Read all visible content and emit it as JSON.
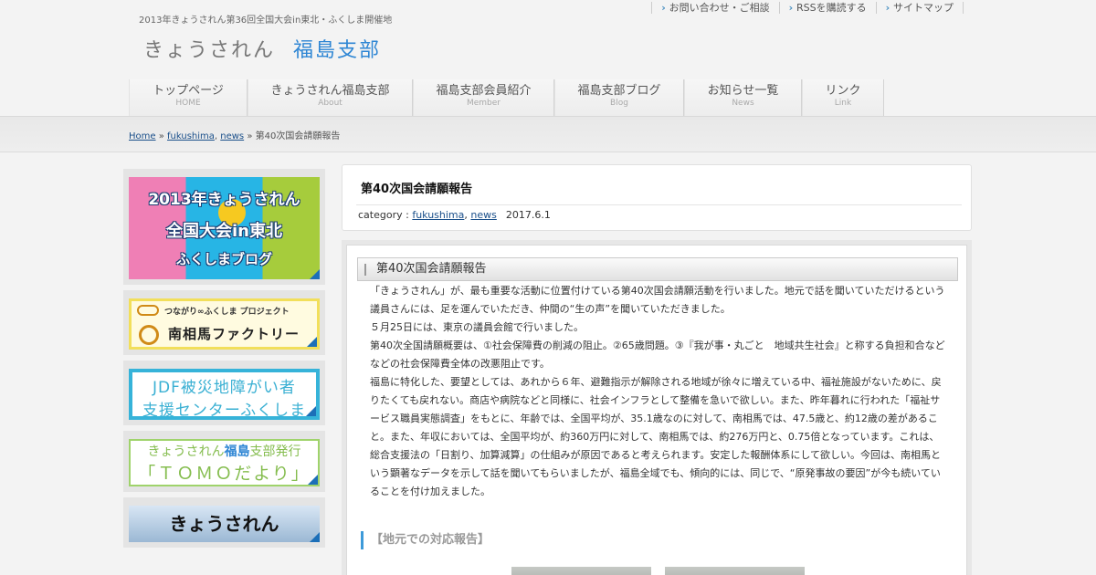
{
  "header": {
    "tagline": "2013年きょうされん第36回全国大会in東北・ふくしま開催地",
    "site_title_main": "きょうされん",
    "site_title_accent": "福島支部",
    "top_links": [
      "お問い合わせ・ご相談",
      "RSSを購読する",
      "サイトマップ"
    ]
  },
  "nav": [
    {
      "jp": "トップページ",
      "en": "HOME"
    },
    {
      "jp": "きょうされん福島支部",
      "en": "About"
    },
    {
      "jp": "福島支部会員紹介",
      "en": "Member"
    },
    {
      "jp": "福島支部ブログ",
      "en": "Blog"
    },
    {
      "jp": "お知らせ一覧",
      "en": "News"
    },
    {
      "jp": "リンク",
      "en": "Link"
    }
  ],
  "breadcrumb": {
    "home": "Home",
    "sep1": " » ",
    "cat1": "fukushima",
    "comma": ", ",
    "cat2": "news",
    "sep2": " » ",
    "current": "第40次国会請願報告"
  },
  "sidebar": {
    "banner1": {
      "line1": "2013年きょうされん",
      "line2": "全国大会in東北",
      "line3": "ふくしまブログ"
    },
    "banner2": {
      "line1": "つながり∞ふくしま プロジェクト",
      "line2": "南相馬ファクトリー"
    },
    "banner3": {
      "line1": "JDF被災地障がい者",
      "line2": "支援センターふくしま"
    },
    "banner4": {
      "pre": "きょうされん",
      "hl": "福島",
      "post": "支部発行",
      "line2": "「ＴＯＭＯだより」"
    },
    "banner5": {
      "line1": "きょうされん"
    }
  },
  "post_card": {
    "title": "第40次国会請願報告",
    "category_label": "category : ",
    "cat1": "fukushima",
    "comma": ", ",
    "cat2": "news",
    "date": "2017.6.1"
  },
  "post": {
    "heading": "第40次国会請願報告",
    "paragraphs": [
      "「きょうされん」が、最も重要な活動に位置付けている第40次国会請願活動を行いました。地元で話を聞いていただけるという議員さんには、足を運んでいただき、仲間の“生の声”を聞いていただきました。",
      "５月25日には、東京の議員会館で行いました。",
      "第40次全国請願概要は、①社会保障費の削減の阻止。②65歳問題。③『我が事・丸ごと　地域共生社会』と称する負担和合などなどの社会保障費全体の改悪阻止です。",
      "福島に特化した、要望としては、あれから６年、避難指示が解除される地域が徐々に増えている中、福祉施設がないために、戻りたくても戻れない。商店や病院などと同様に、社会インフラとして整備を急いで欲しい。また、昨年暮れに行われた「福祉サービス職員実態調査」をもとに、年齢では、全国平均が、35.1歳なのに対して、南相馬では、47.5歳と、約12歳の差があること。また、年収においては、全国平均が、約360万円に対して、南相馬では、約276万円と、0.75倍となっています。これは、総合支援法の「日割り、加算減算」の仕組みが原因であると考えられます。安定した報酬体系にして欲しい。今回は、南相馬という顕著なデータを示して話を聞いてもらいましたが、福島全域でも、傾向的には、同じで、“原発事故の要因”が今も続いていることを付け加えました。"
    ],
    "sub_heading": "【地元での対応報告】"
  }
}
